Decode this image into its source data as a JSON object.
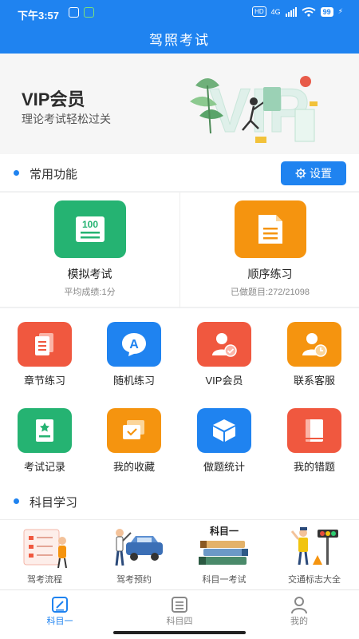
{
  "status_bar": {
    "time": "下午3:57",
    "network": "4G",
    "battery": "99"
  },
  "app": {
    "title": "驾照考试"
  },
  "banner": {
    "title": "VIP会员",
    "subtitle": "理论考试轻松过关",
    "art_text": "VIP"
  },
  "common": {
    "title": "常用功能",
    "settings_label": "设置"
  },
  "main_features": [
    {
      "label": "模拟考试",
      "sub": "平均成绩:1分",
      "icon": "exam-paper-icon",
      "icon_text": "100",
      "color": "#25b372"
    },
    {
      "label": "顺序练习",
      "sub": "已做题目:272/21098",
      "icon": "document-icon",
      "color": "#f5940f"
    }
  ],
  "features": [
    {
      "label": "章节练习",
      "icon": "chapter-pages-icon",
      "color": "#f0583f"
    },
    {
      "label": "随机练习",
      "icon": "random-a-icon",
      "icon_text": "A",
      "color": "#1f83f0"
    },
    {
      "label": "VIP会员",
      "icon": "vip-user-icon",
      "color": "#f0583f"
    },
    {
      "label": "联系客服",
      "icon": "support-user-icon",
      "color": "#f5940f"
    },
    {
      "label": "考试记录",
      "icon": "exam-record-icon",
      "color": "#25b372"
    },
    {
      "label": "我的收藏",
      "icon": "favorites-icon",
      "color": "#f5940f"
    },
    {
      "label": "做题统计",
      "icon": "stats-box-icon",
      "color": "#1f83f0"
    },
    {
      "label": "我的错题",
      "icon": "wrong-book-icon",
      "color": "#f0583f"
    }
  ],
  "subjects": {
    "title": "科目学习",
    "items": [
      {
        "label": "驾考流程",
        "icon": "process-illustration-icon"
      },
      {
        "label": "驾考预约",
        "icon": "car-appointment-icon"
      },
      {
        "label": "科目一考试",
        "icon": "books-icon",
        "icon_text": "科目一"
      },
      {
        "label": "交通标志大全",
        "icon": "traffic-police-icon"
      }
    ]
  },
  "tabs": [
    {
      "label": "科目一",
      "active": true
    },
    {
      "label": "科目四",
      "active": false
    },
    {
      "label": "我的",
      "active": false
    }
  ],
  "colors": {
    "primary": "#1f83f0",
    "green": "#25b372",
    "orange": "#f5940f",
    "red": "#f0583f"
  }
}
